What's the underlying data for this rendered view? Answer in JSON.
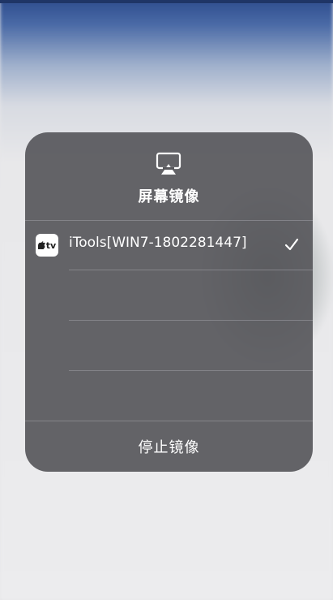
{
  "panel": {
    "title": "屏幕镜像",
    "icon": "airplay-icon",
    "devices": [
      {
        "name": "iTools[WIN7-1802281447]",
        "icon": "apple-tv-icon",
        "icon_text": "tv",
        "selected": true
      }
    ],
    "stop_label": "停止镜像"
  }
}
